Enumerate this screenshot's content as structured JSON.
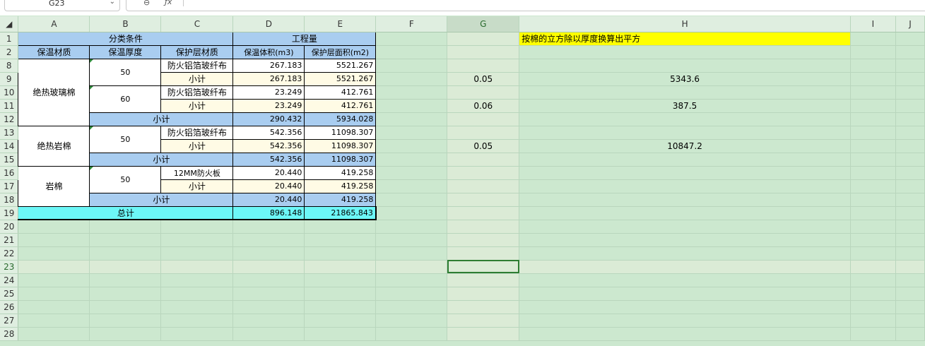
{
  "name_box": {
    "value": "G23"
  },
  "formula_bar": {
    "zoom_icon": "zoom-icon",
    "fx_label": "ƒx",
    "value": ""
  },
  "columns": [
    "A",
    "B",
    "C",
    "D",
    "E",
    "F",
    "G",
    "H",
    "I",
    "J"
  ],
  "rows": [
    "1",
    "2",
    "8",
    "9",
    "10",
    "11",
    "12",
    "13",
    "14",
    "15",
    "16",
    "17",
    "18",
    "19",
    "20",
    "21",
    "22",
    "23",
    "24",
    "25",
    "26",
    "27",
    "28"
  ],
  "selected": {
    "cell": "G23",
    "column": "G",
    "row": "23"
  },
  "table": {
    "header1": {
      "group1": "分类条件",
      "group2": "工程量"
    },
    "header2": {
      "a": "保温材质",
      "b": "保温厚度",
      "c": "保护层材质",
      "d": "保温体积(m3)",
      "e": "保护层面积(m2)"
    },
    "note": "按棉的立方除以厚度换算出平方",
    "r8": {
      "a": "绝热玻璃棉",
      "b": "50",
      "c": "防火铝箔玻纤布",
      "d": "267.183",
      "e": "5521.267"
    },
    "r9": {
      "c": "小计",
      "d": "267.183",
      "e": "5521.267",
      "g": "0.05",
      "h": "5343.6"
    },
    "r10": {
      "b": "60",
      "c": "防火铝箔玻纤布",
      "d": "23.249",
      "e": "412.761"
    },
    "r11": {
      "c": "小计",
      "d": "23.249",
      "e": "412.761",
      "g": "0.06",
      "h": "387.5"
    },
    "r12": {
      "label": "小计",
      "d": "290.432",
      "e": "5934.028"
    },
    "r13": {
      "a": "绝热岩棉",
      "b": "50",
      "c": "防火铝箔玻纤布",
      "d": "542.356",
      "e": "11098.307"
    },
    "r14": {
      "c": "小计",
      "d": "542.356",
      "e": "11098.307",
      "g": "0.05",
      "h": "10847.2"
    },
    "r15": {
      "label": "小计",
      "d": "542.356",
      "e": "11098.307"
    },
    "r16": {
      "a": "岩棉",
      "b": "50",
      "c": "12MM防火板",
      "d": "20.440",
      "e": "419.258"
    },
    "r17": {
      "c": "小计",
      "d": "20.440",
      "e": "419.258"
    },
    "r18": {
      "label": "小计",
      "d": "20.440",
      "e": "419.258"
    },
    "r19": {
      "label": "总计",
      "d": "896.148",
      "e": "21865.843"
    }
  },
  "colors": {
    "header_blue": "#a9cdf0",
    "subtotal_cream": "#fffbe5",
    "total_cyan": "#6cf7f7",
    "note_yellow": "#ffff00",
    "sheet_green": "#cce8cf",
    "selection": "#2e7d32"
  }
}
